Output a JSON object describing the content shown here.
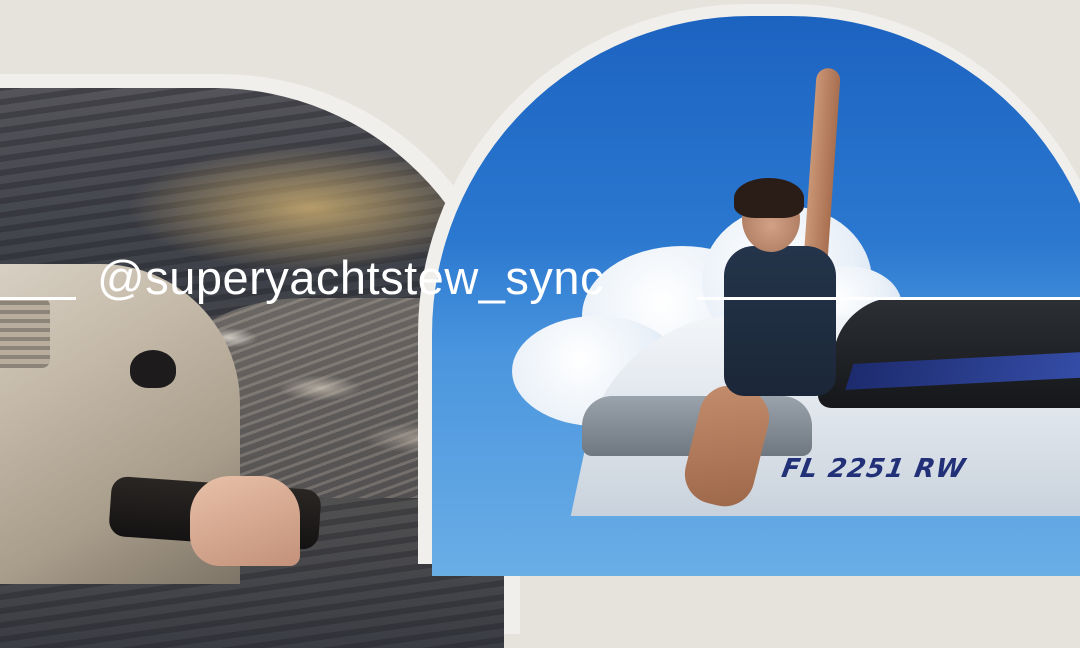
{
  "overlay": {
    "handle": "@superyachtstew_sync"
  },
  "photos": {
    "right": {
      "hull_text": "FL 2251 RW"
    }
  },
  "colors": {
    "background": "#e6e2dc",
    "frame_outline": "#f1efeb",
    "text": "#ffffff",
    "sky": "#2b78d0"
  }
}
